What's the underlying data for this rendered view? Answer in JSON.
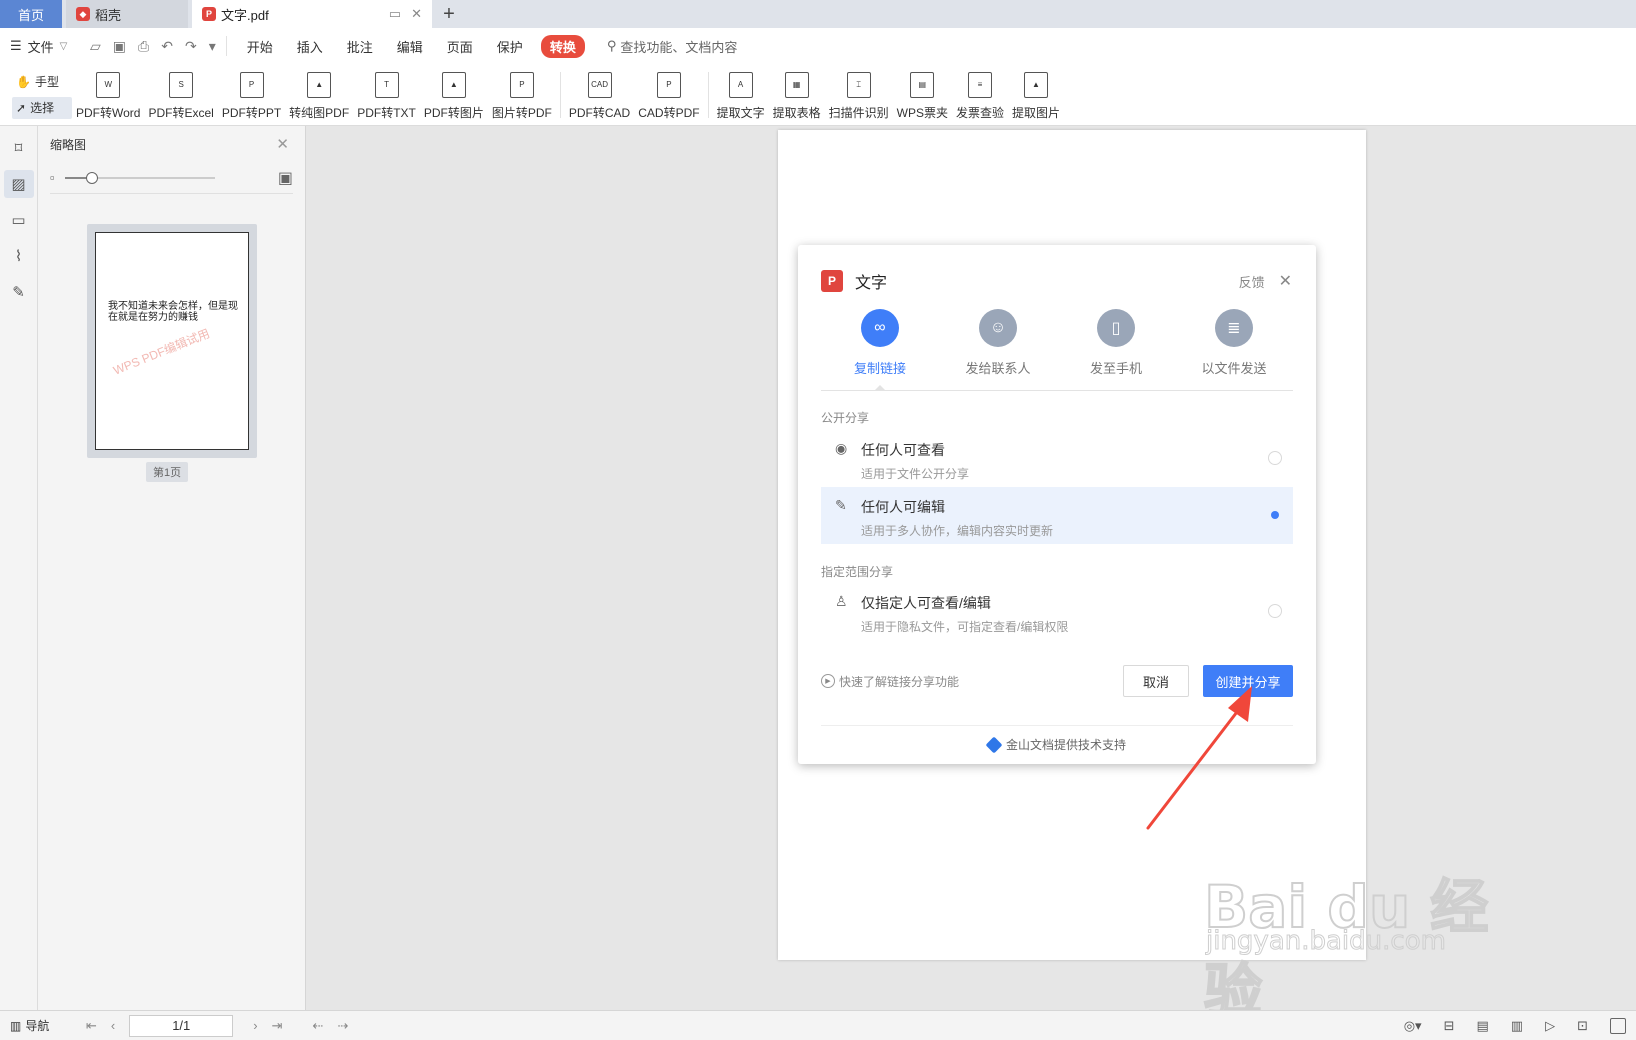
{
  "tabs": {
    "home": "首页",
    "daoke": "稻壳",
    "active": "文字.pdf"
  },
  "menu": {
    "file": "文件",
    "items": [
      "开始",
      "插入",
      "批注",
      "编辑",
      "页面",
      "保护"
    ],
    "active_item": "转换",
    "search_placeholder": "查找功能、文档内容"
  },
  "ribbon": {
    "mode_hand": "手型",
    "mode_select": "选择",
    "group1": [
      {
        "label": "PDF转Word",
        "glyph": "W"
      },
      {
        "label": "PDF转Excel",
        "glyph": "S"
      },
      {
        "label": "PDF转PPT",
        "glyph": "P"
      },
      {
        "label": "转纯图PDF",
        "glyph": "▲"
      },
      {
        "label": "PDF转TXT",
        "glyph": "T"
      },
      {
        "label": "PDF转图片",
        "glyph": "▲"
      },
      {
        "label": "图片转PDF",
        "glyph": "P"
      }
    ],
    "group2": [
      {
        "label": "PDF转CAD",
        "glyph": "CAD"
      },
      {
        "label": "CAD转PDF",
        "glyph": "P"
      }
    ],
    "group3": [
      {
        "label": "提取文字",
        "glyph": "A"
      },
      {
        "label": "提取表格",
        "glyph": "▦"
      },
      {
        "label": "扫描件识别",
        "glyph": "⌶"
      },
      {
        "label": "WPS票夹",
        "glyph": "▤"
      },
      {
        "label": "发票查验",
        "glyph": "≡"
      },
      {
        "label": "提取图片",
        "glyph": "▲"
      }
    ]
  },
  "thumbnail_panel": {
    "title": "缩略图",
    "zoom_level": 0.18,
    "page_text": "我不知道未来会怎样，但是现在就是在努力的赚钱",
    "watermark": "WPS PDF编辑试用",
    "page_label": "第1页"
  },
  "dialog": {
    "file_name": "文字",
    "feedback": "反馈",
    "share_tabs": [
      {
        "label": "复制链接",
        "icon": "link-icon",
        "active": true
      },
      {
        "label": "发给联系人",
        "icon": "contact-icon",
        "active": false
      },
      {
        "label": "发至手机",
        "icon": "phone-icon",
        "active": false
      },
      {
        "label": "以文件发送",
        "icon": "file-icon",
        "active": false
      }
    ],
    "public_section": "公开分享",
    "options_public": [
      {
        "title": "任何人可查看",
        "desc": "适用于文件公开分享",
        "selected": false
      },
      {
        "title": "任何人可编辑",
        "desc": "适用于多人协作，编辑内容实时更新",
        "selected": true
      }
    ],
    "restricted_section": "指定范围分享",
    "option_restricted": {
      "title": "仅指定人可查看/编辑",
      "desc": "适用于隐私文件，可指定查看/编辑权限",
      "selected": false
    },
    "learn_link": "快速了解链接分享功能",
    "cancel": "取消",
    "create": "创建并分享",
    "powered_by": "金山文档提供技术支持"
  },
  "status_bar": {
    "nav": "导航",
    "page": "1/1"
  },
  "colors": {
    "accent": "#3f7ef8",
    "convert_tab": "#e84c3d",
    "annotation_arrow": "#f0473a"
  }
}
